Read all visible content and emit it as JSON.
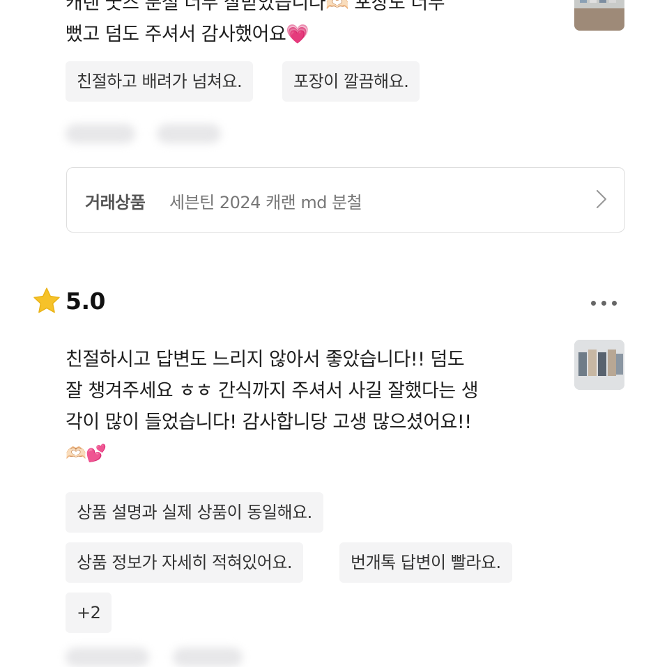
{
  "review1": {
    "text_lines": [
      "캐랜 굿즈 분철 너무 잘받았습니다🫶🏻 포장도 너무",
      "뻤고 덤도 주셔서 감사했어요"
    ],
    "heart": "💗",
    "tags": [
      "친절하고 배려가 넘쳐요.",
      "포장이 깔끔해요."
    ]
  },
  "product": {
    "label": "거래상품",
    "name": "세븐틴 2024 캐랜 md 분철",
    "chevron_icon": "chevron-right-icon"
  },
  "review2": {
    "star_icon": "star-icon",
    "rating": "5.0",
    "more_icon": "more-horizontal-icon",
    "text_lines": [
      "친절하시고 답변도 느리지 않아서 좋았습니다!! 덤도",
      "잘 챙겨주세요 ㅎㅎ 간식까지 주셔서 사길 잘했다는 생",
      "각이 많이 들었습니다! 감사합니당 고생 많으셨어요!!"
    ],
    "emoji_line": "🫶🏻💕",
    "tags": [
      "상품 설명과 실제 상품이 동일해요.",
      "상품 정보가 자세히 적혀있어요.",
      "번개톡 답변이 빨라요."
    ],
    "more_tags": "+2"
  },
  "colors": {
    "tag_bg": "#f4f4f5",
    "star": "#f6c229",
    "heart": "#ff4fa6"
  }
}
